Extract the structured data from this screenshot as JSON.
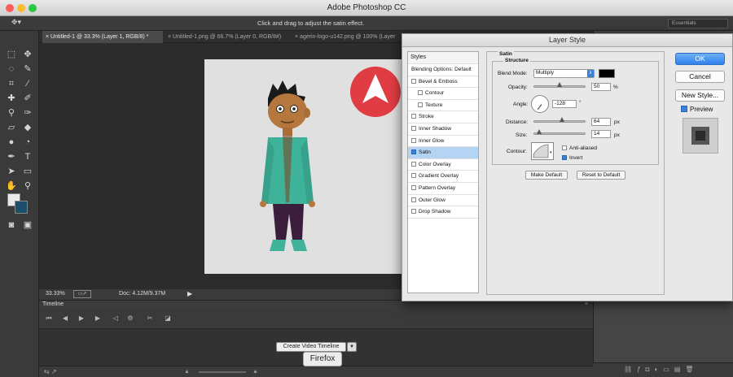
{
  "window": {
    "title": "Adobe Photoshop CC"
  },
  "options_bar": {
    "hint": "Click and drag to adjust the satin effect.",
    "workspace": "Essentials"
  },
  "doc_tabs": [
    {
      "label": "Untitled-1 @ 33.3% (Layer 1, RGB/8) *",
      "active": true
    },
    {
      "label": "Untitled-1.png @ 66.7% (Layer 0, RGB/8#)",
      "active": false
    },
    {
      "label": "agerin-logo-u142.png @ 100% (Layer",
      "active": false
    }
  ],
  "status_bar": {
    "zoom": "33.33%",
    "doc": "Doc: 4.12M/9.37M"
  },
  "timeline": {
    "title": "Timeline",
    "create_button": "Create Video Timeline"
  },
  "tooltip": "Firefox",
  "dialog": {
    "title": "Layer Style",
    "styles_header": "Styles",
    "styles": [
      {
        "label": "Blending Options: Default",
        "checkbox": false,
        "checked": false,
        "indent": false
      },
      {
        "label": "Bevel & Emboss",
        "checkbox": true,
        "checked": false,
        "indent": false
      },
      {
        "label": "Contour",
        "checkbox": true,
        "checked": false,
        "indent": true
      },
      {
        "label": "Texture",
        "checkbox": true,
        "checked": false,
        "indent": true
      },
      {
        "label": "Stroke",
        "checkbox": true,
        "checked": false,
        "indent": false
      },
      {
        "label": "Inner Shadow",
        "checkbox": true,
        "checked": false,
        "indent": false
      },
      {
        "label": "Inner Glow",
        "checkbox": true,
        "checked": false,
        "indent": false
      },
      {
        "label": "Satin",
        "checkbox": true,
        "checked": true,
        "indent": false,
        "selected": true
      },
      {
        "label": "Color Overlay",
        "checkbox": true,
        "checked": false,
        "indent": false
      },
      {
        "label": "Gradient Overlay",
        "checkbox": true,
        "checked": false,
        "indent": false
      },
      {
        "label": "Pattern Overlay",
        "checkbox": true,
        "checked": false,
        "indent": false
      },
      {
        "label": "Outer Glow",
        "checkbox": true,
        "checked": false,
        "indent": false
      },
      {
        "label": "Drop Shadow",
        "checkbox": true,
        "checked": false,
        "indent": false
      }
    ],
    "satin": {
      "group_title": "Satin",
      "structure_title": "Structure",
      "blend_mode_label": "Blend Mode:",
      "blend_mode": "Multiply",
      "color": "#000000",
      "opacity_label": "Opacity:",
      "opacity": "50",
      "opacity_unit": "%",
      "angle_label": "Angle:",
      "angle": "-128",
      "angle_unit": "°",
      "distance_label": "Distance:",
      "distance": "64",
      "distance_unit": "px",
      "size_label": "Size:",
      "size": "14",
      "size_unit": "px",
      "contour_label": "Contour:",
      "anti_aliased_label": "Anti-aliased",
      "anti_aliased": false,
      "invert_label": "Invert",
      "invert": true,
      "make_default": "Make Default",
      "reset_default": "Reset to Default"
    },
    "buttons": {
      "ok": "OK",
      "cancel": "Cancel",
      "new_style": "New Style...",
      "preview": "Preview",
      "preview_checked": true
    }
  },
  "colors": {
    "accent": "#2f82ea",
    "logo_red": "#e03c44",
    "shirt": "#3fb39a",
    "pants": "#3a1e3c"
  }
}
